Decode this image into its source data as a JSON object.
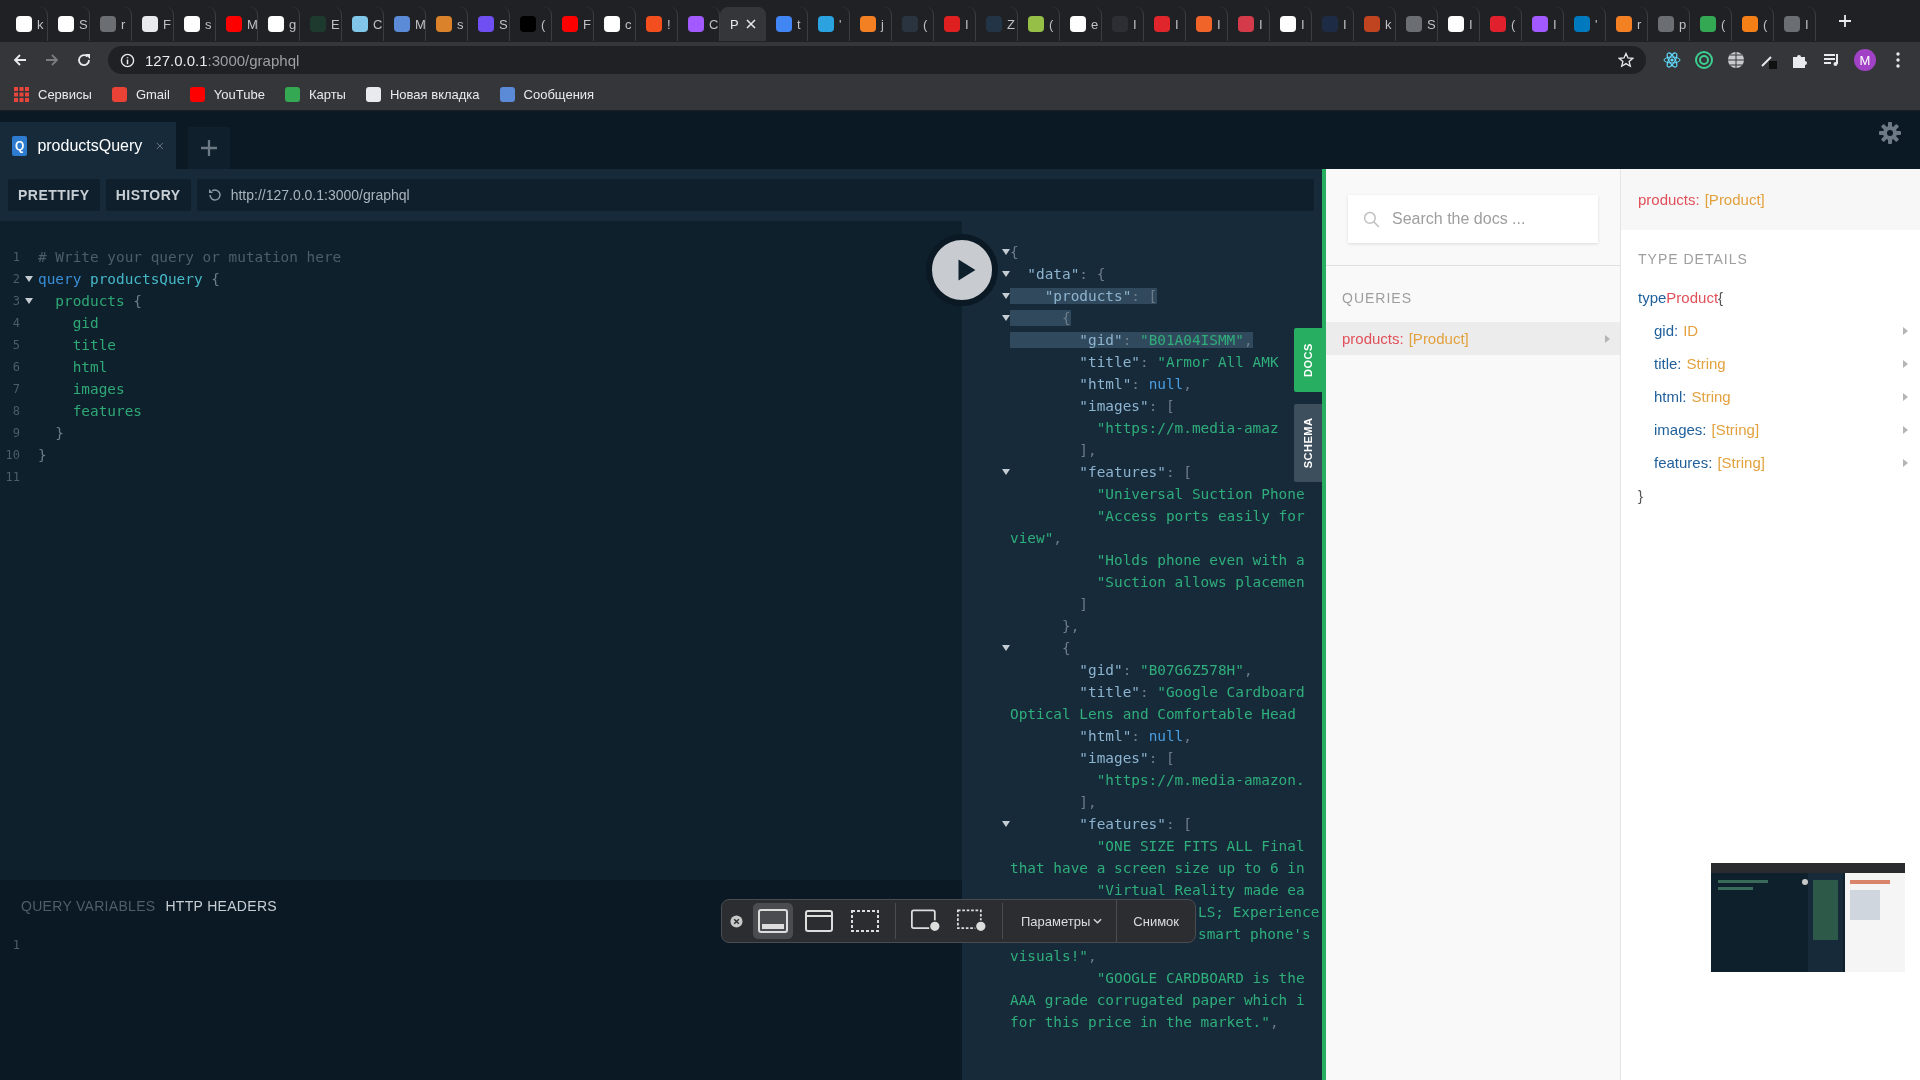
{
  "browser": {
    "tabs": [
      {
        "title": "k",
        "color": "#ffffff",
        "selected": false
      },
      {
        "title": "S",
        "color": "#ffffff",
        "selected": false
      },
      {
        "title": "r",
        "color": "#6b6e73",
        "selected": false
      },
      {
        "title": "F",
        "color": "#e8eaed",
        "selected": false
      },
      {
        "title": "s",
        "color": "#ffffff",
        "selected": false
      },
      {
        "title": "M",
        "color": "#ff0000",
        "selected": false
      },
      {
        "title": "g",
        "color": "#ffffff",
        "selected": false
      },
      {
        "title": "E",
        "color": "#1e3a2e",
        "selected": false
      },
      {
        "title": "C",
        "color": "#7fc6e8",
        "selected": false
      },
      {
        "title": "M",
        "color": "#5b8ad6",
        "selected": false
      },
      {
        "title": "s",
        "color": "#d9822b",
        "selected": false
      },
      {
        "title": "S",
        "color": "#6f4ef2",
        "selected": false
      },
      {
        "title": "(",
        "color": "#000000",
        "selected": false
      },
      {
        "title": "F",
        "color": "#ff0000",
        "selected": false
      },
      {
        "title": "c",
        "color": "#ffffff",
        "selected": false
      },
      {
        "title": "!",
        "color": "#f24e1e",
        "selected": false
      },
      {
        "title": "C",
        "color": "#a259ff",
        "selected": false
      },
      {
        "title": "P",
        "selected": true
      },
      {
        "title": "t",
        "color": "#4285f4",
        "selected": false
      },
      {
        "title": "'",
        "color": "#2aa3e0",
        "selected": false
      },
      {
        "title": "j",
        "color": "#f48024",
        "selected": false
      },
      {
        "title": "(",
        "color": "#2a3440",
        "selected": false
      },
      {
        "title": "I",
        "color": "#e02020",
        "selected": false
      },
      {
        "title": "Z",
        "color": "#243447",
        "selected": false
      },
      {
        "title": "(",
        "color": "#95bf47",
        "selected": false
      },
      {
        "title": "e",
        "color": "#ffffff",
        "selected": false
      },
      {
        "title": "I",
        "color": "#2c2e33",
        "selected": false
      },
      {
        "title": "I",
        "color": "#e0262b",
        "selected": false
      },
      {
        "title": "I",
        "color": "#f0642a",
        "selected": false
      },
      {
        "title": "I",
        "color": "#d33a4a",
        "selected": false
      },
      {
        "title": "I",
        "color": "#ffffff",
        "selected": false
      },
      {
        "title": "I",
        "color": "#1d2b45",
        "selected": false
      },
      {
        "title": "k",
        "color": "#c0441f",
        "selected": false
      },
      {
        "title": "S",
        "color": "#6b6e73",
        "selected": false
      },
      {
        "title": "I",
        "color": "#ffffff",
        "selected": false
      },
      {
        "title": "(",
        "color": "#e0202c",
        "selected": false
      },
      {
        "title": "I",
        "color": "#a259ff",
        "selected": false
      },
      {
        "title": "'",
        "color": "#0079bf",
        "selected": false
      },
      {
        "title": "r",
        "color": "#f48024",
        "selected": false
      },
      {
        "title": "p",
        "color": "#6b6e73",
        "selected": false
      },
      {
        "title": "(",
        "color": "#34a853",
        "selected": false
      },
      {
        "title": "(",
        "color": "#f57f17",
        "selected": false
      },
      {
        "title": "I",
        "color": "#6b6e73",
        "selected": false
      }
    ],
    "address": {
      "host": "127.0.0.1",
      "path": ":3000/graphql"
    },
    "avatar": "M",
    "bookmarks": [
      {
        "kind": "apps",
        "label": "Сервисы",
        "color": "#e8453c"
      },
      {
        "kind": "site",
        "label": "Gmail",
        "color": "#ea4335"
      },
      {
        "kind": "site",
        "label": "YouTube",
        "color": "#ff0000"
      },
      {
        "kind": "site",
        "label": "Карты",
        "color": "#34a853"
      },
      {
        "kind": "site",
        "label": "Новая вкладка",
        "color": "#e8eaed"
      },
      {
        "kind": "site",
        "label": "Сообщения",
        "color": "#5b8ad6"
      }
    ]
  },
  "playground": {
    "tabs": [
      {
        "badge": "Q",
        "title": "productsQuery",
        "selected": true
      }
    ],
    "toolbar": {
      "buttons": [
        "PRETTIFY",
        "HISTORY"
      ],
      "endpoint": "http://127.0.0.1:3000/graphql"
    },
    "editor": {
      "lines": [
        {
          "number": "1",
          "foldable": false,
          "tokens": [
            {
              "kind": "comment",
              "text": "# Write your query or mutation here"
            }
          ]
        },
        {
          "number": "2",
          "foldable": true,
          "tokens": [
            {
              "kind": "keyword",
              "text": "query "
            },
            {
              "kind": "def",
              "text": "productsQuery"
            },
            {
              "kind": "punct",
              "text": " {"
            }
          ]
        },
        {
          "number": "3",
          "foldable": true,
          "tokens": [
            {
              "kind": "field",
              "text": "  products"
            },
            {
              "kind": "punct",
              "text": " {"
            }
          ]
        },
        {
          "number": "4",
          "foldable": false,
          "tokens": [
            {
              "kind": "field",
              "text": "    gid"
            }
          ]
        },
        {
          "number": "5",
          "foldable": false,
          "tokens": [
            {
              "kind": "field",
              "text": "    title"
            }
          ]
        },
        {
          "number": "6",
          "foldable": false,
          "tokens": [
            {
              "kind": "field",
              "text": "    html"
            }
          ]
        },
        {
          "number": "7",
          "foldable": false,
          "tokens": [
            {
              "kind": "field",
              "text": "    images"
            }
          ]
        },
        {
          "number": "8",
          "foldable": false,
          "tokens": [
            {
              "kind": "field",
              "text": "    features"
            }
          ]
        },
        {
          "number": "9",
          "foldable": false,
          "tokens": [
            {
              "kind": "punct",
              "text": "  }"
            }
          ]
        },
        {
          "number": "10",
          "foldable": false,
          "tokens": [
            {
              "kind": "punct",
              "text": "}"
            }
          ]
        },
        {
          "number": "11",
          "foldable": false
        }
      ]
    },
    "result": {
      "lines": [
        {
          "kind": "code",
          "foldable": true,
          "highlighted": false,
          "tokens": [
            {
              "kind": "punct",
              "text": "{"
            }
          ]
        },
        {
          "kind": "code",
          "foldable": true,
          "highlighted": false,
          "tokens": [
            {
              "kind": "key",
              "text": "  \"data\""
            },
            {
              "kind": "punct",
              "text": ": {"
            }
          ]
        },
        {
          "kind": "code",
          "foldable": true,
          "highlighted": true,
          "tokens": [
            {
              "kind": "key",
              "text": "    \"products\""
            },
            {
              "kind": "punct",
              "text": ": ["
            }
          ]
        },
        {
          "kind": "code",
          "foldable": true,
          "highlighted": true,
          "tokens": [
            {
              "kind": "punct",
              "text": "      {"
            }
          ]
        },
        {
          "kind": "code",
          "foldable": false,
          "highlighted": true,
          "tokens": [
            {
              "kind": "key",
              "text": "        \"gid\""
            },
            {
              "kind": "punct",
              "text": ": "
            },
            {
              "kind": "string",
              "text": "\"B01A04ISMM\""
            },
            {
              "kind": "punct",
              "text": ","
            }
          ]
        },
        {
          "kind": "code",
          "foldable": false,
          "highlighted": false,
          "tokens": [
            {
              "kind": "key",
              "text": "        \"title\""
            },
            {
              "kind": "punct",
              "text": ": "
            },
            {
              "kind": "string",
              "text": "\"Armor All AMK"
            }
          ]
        },
        {
          "kind": "code",
          "foldable": false,
          "highlighted": false,
          "tokens": [
            {
              "kind": "key",
              "text": "        \"html\""
            },
            {
              "kind": "punct",
              "text": ": "
            },
            {
              "kind": "null",
              "text": "null"
            },
            {
              "kind": "punct",
              "text": ","
            }
          ]
        },
        {
          "kind": "code",
          "foldable": false,
          "highlighted": false,
          "tokens": [
            {
              "kind": "key",
              "text": "        \"images\""
            },
            {
              "kind": "punct",
              "text": ": ["
            }
          ]
        },
        {
          "kind": "code",
          "foldable": false,
          "highlighted": false,
          "tokens": [
            {
              "kind": "string",
              "text": "          \"https://m.media-amaz"
            }
          ]
        },
        {
          "kind": "code",
          "foldable": false,
          "highlighted": false,
          "tokens": [
            {
              "kind": "punct",
              "text": "        ],"
            }
          ]
        },
        {
          "kind": "code",
          "foldable": true,
          "highlighted": false,
          "tokens": [
            {
              "kind": "key",
              "text": "        \"features\""
            },
            {
              "kind": "punct",
              "text": ": ["
            }
          ]
        },
        {
          "kind": "code",
          "foldable": false,
          "highlighted": false,
          "tokens": [
            {
              "kind": "string",
              "text": "          \"Universal Suction Phone"
            }
          ]
        },
        {
          "kind": "code",
          "foldable": false,
          "highlighted": false,
          "tokens": [
            {
              "kind": "string",
              "text": "          \"Access ports easily for"
            }
          ]
        },
        {
          "kind": "code",
          "foldable": false,
          "highlighted": false,
          "tokens": [
            {
              "kind": "string",
              "text": "view\""
            },
            {
              "kind": "punct",
              "text": ","
            }
          ]
        },
        {
          "kind": "code",
          "foldable": false,
          "highlighted": false,
          "tokens": [
            {
              "kind": "string",
              "text": "          \"Holds phone even with a"
            }
          ]
        },
        {
          "kind": "code",
          "foldable": false,
          "highlighted": false,
          "tokens": [
            {
              "kind": "string",
              "text": "          \"Suction allows placemen"
            }
          ]
        },
        {
          "kind": "code",
          "foldable": false,
          "highlighted": false,
          "tokens": [
            {
              "kind": "punct",
              "text": "        ]"
            }
          ]
        },
        {
          "kind": "code",
          "foldable": false,
          "highlighted": false,
          "tokens": [
            {
              "kind": "punct",
              "text": "      },"
            }
          ]
        },
        {
          "kind": "code",
          "foldable": true,
          "highlighted": false,
          "tokens": [
            {
              "kind": "punct",
              "text": "      {"
            }
          ]
        },
        {
          "kind": "code",
          "foldable": false,
          "highlighted": false,
          "tokens": [
            {
              "kind": "key",
              "text": "        \"gid\""
            },
            {
              "kind": "punct",
              "text": ": "
            },
            {
              "kind": "string",
              "text": "\"B07G6Z578H\""
            },
            {
              "kind": "punct",
              "text": ","
            }
          ]
        },
        {
          "kind": "code",
          "foldable": false,
          "highlighted": false,
          "tokens": [
            {
              "kind": "key",
              "text": "        \"title\""
            },
            {
              "kind": "punct",
              "text": ": "
            },
            {
              "kind": "string",
              "text": "\"Google Cardboard"
            }
          ]
        },
        {
          "kind": "code",
          "foldable": false,
          "highlighted": false,
          "tokens": [
            {
              "kind": "string",
              "text": "Optical Lens and Comfortable Head"
            }
          ]
        },
        {
          "kind": "code",
          "foldable": false,
          "highlighted": false,
          "tokens": [
            {
              "kind": "key",
              "text": "        \"html\""
            },
            {
              "kind": "punct",
              "text": ": "
            },
            {
              "kind": "null",
              "text": "null"
            },
            {
              "kind": "punct",
              "text": ","
            }
          ]
        },
        {
          "kind": "code",
          "foldable": false,
          "highlighted": false,
          "tokens": [
            {
              "kind": "key",
              "text": "        \"images\""
            },
            {
              "kind": "punct",
              "text": ": ["
            }
          ]
        },
        {
          "kind": "code",
          "foldable": false,
          "highlighted": false,
          "tokens": [
            {
              "kind": "string",
              "text": "          \"https://m.media-amazon."
            }
          ]
        },
        {
          "kind": "code",
          "foldable": false,
          "highlighted": false,
          "tokens": [
            {
              "kind": "punct",
              "text": "        ],"
            }
          ]
        },
        {
          "kind": "code",
          "foldable": true,
          "highlighted": false,
          "tokens": [
            {
              "kind": "key",
              "text": "        \"features\""
            },
            {
              "kind": "punct",
              "text": ": ["
            }
          ]
        },
        {
          "kind": "code",
          "foldable": false,
          "highlighted": false,
          "tokens": [
            {
              "kind": "string",
              "text": "          \"ONE SIZE FITS ALL Final"
            }
          ]
        },
        {
          "kind": "code",
          "foldable": false,
          "highlighted": false,
          "tokens": [
            {
              "kind": "string",
              "text": "that have a screen size up to 6 in"
            }
          ]
        },
        {
          "kind": "code",
          "foldable": false,
          "highlighted": false,
          "tokens": [
            {
              "kind": "string",
              "text": "          \"Virtual Reality made ea"
            }
          ]
        },
        {
          "kind": "tail",
          "highlighted": false,
          "tokens": [
            {
              "kind": "string",
              "text": "LS; Experience"
            }
          ]
        },
        {
          "kind": "tail",
          "highlighted": false,
          "tokens": [
            {
              "kind": "string",
              "text": "smart phone's"
            }
          ]
        },
        {
          "kind": "code",
          "foldable": false,
          "highlighted": false,
          "tokens": [
            {
              "kind": "string",
              "text": "visuals!\""
            },
            {
              "kind": "punct",
              "text": ","
            }
          ]
        },
        {
          "kind": "code",
          "foldable": false,
          "highlighted": false,
          "tokens": [
            {
              "kind": "string",
              "text": "          \"GOOGLE CARDBOARD is the"
            }
          ]
        },
        {
          "kind": "code",
          "foldable": false,
          "highlighted": false,
          "tokens": [
            {
              "kind": "string",
              "text": "AAA grade corrugated paper which i"
            }
          ]
        },
        {
          "kind": "code",
          "foldable": false,
          "highlighted": false,
          "tokens": [
            {
              "kind": "string",
              "text": "for this price in the market.\""
            },
            {
              "kind": "punct",
              "text": ","
            }
          ]
        }
      ]
    },
    "side_tabs": [
      {
        "label": "DOCS",
        "selected": true
      },
      {
        "label": "SCHEMA",
        "selected": false
      }
    ],
    "variables": {
      "tabs": [
        {
          "label": "QUERY VARIABLES",
          "selected": false
        },
        {
          "label": "HTTP HEADERS",
          "selected": true
        }
      ],
      "lines": [
        "1"
      ]
    }
  },
  "docs": {
    "search": {
      "placeholder": "Search the docs ..."
    },
    "section": "QUERIES",
    "queries": [
      {
        "name": "products:",
        "type": "[Product]",
        "selected": true
      }
    ],
    "header": {
      "name": "products:",
      "type": "[Product]"
    },
    "details_title": "TYPE DETAILS",
    "type_keyword": "type",
    "type_name": "Product",
    "open_brace": "{",
    "fields": [
      {
        "name": "gid:",
        "type": "ID"
      },
      {
        "name": "title:",
        "type": "String"
      },
      {
        "name": "html:",
        "type": "String"
      },
      {
        "name": "images:",
        "type": "[String]"
      },
      {
        "name": "features:",
        "type": "[String]"
      }
    ],
    "close_brace": "}"
  },
  "capture_toolbar": {
    "modes": [
      {
        "kind": "screen",
        "selected": true
      },
      {
        "kind": "window",
        "selected": false
      },
      {
        "kind": "selection",
        "selected": false
      },
      {
        "kind": "record-screen",
        "selected": false
      },
      {
        "kind": "record-selection",
        "selected": false
      }
    ],
    "options": "Параметры",
    "action": "Снимок"
  }
}
